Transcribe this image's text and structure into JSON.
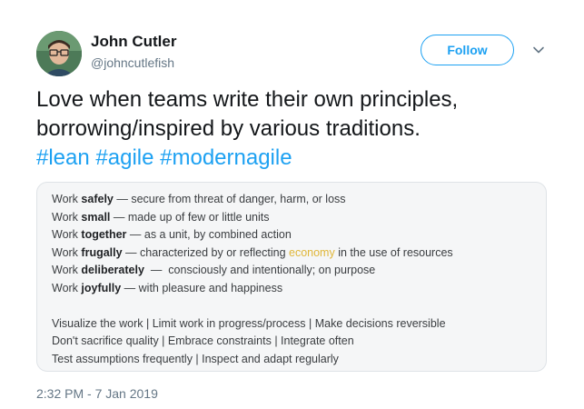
{
  "author": {
    "name": "John Cutler",
    "handle": "@johncutlefish"
  },
  "follow_label": "Follow",
  "menu_icon": "chevron-down-icon",
  "tweet": {
    "line1": "Love when teams write their own principles,",
    "line2": "borrowing/inspired by various traditions.",
    "hashtags": [
      "#lean",
      "#agile",
      "#modernagile"
    ]
  },
  "image": {
    "principles": [
      {
        "prefix": "Work ",
        "keyword": "safely",
        "definition": " — secure from threat of danger, harm, or loss"
      },
      {
        "prefix": "Work ",
        "keyword": "small",
        "definition": " — made up of few or little units"
      },
      {
        "prefix": "Work ",
        "keyword": "together",
        "definition": " — as a unit, by combined action"
      },
      {
        "prefix": "Work ",
        "keyword": "frugally",
        "definition_pre": " — characterized by or reflecting ",
        "highlight": "economy",
        "definition_post": " in the use of resources"
      },
      {
        "prefix": "Work ",
        "keyword": "deliberately",
        "definition": "  —  consciously and intentionally; on purpose"
      },
      {
        "prefix": "Work ",
        "keyword": "joyfully",
        "definition": " — with pleasure and happiness"
      }
    ],
    "practices": [
      "Visualize the work | Limit work in progress/process | Make decisions reversible",
      "Don't sacrifice quality | Embrace constraints | Integrate often",
      "Test assumptions frequently | Inspect and adapt regularly"
    ],
    "highlight_color": "#e0b73a"
  },
  "timestamp": "2:32 PM - 7 Jan 2019"
}
